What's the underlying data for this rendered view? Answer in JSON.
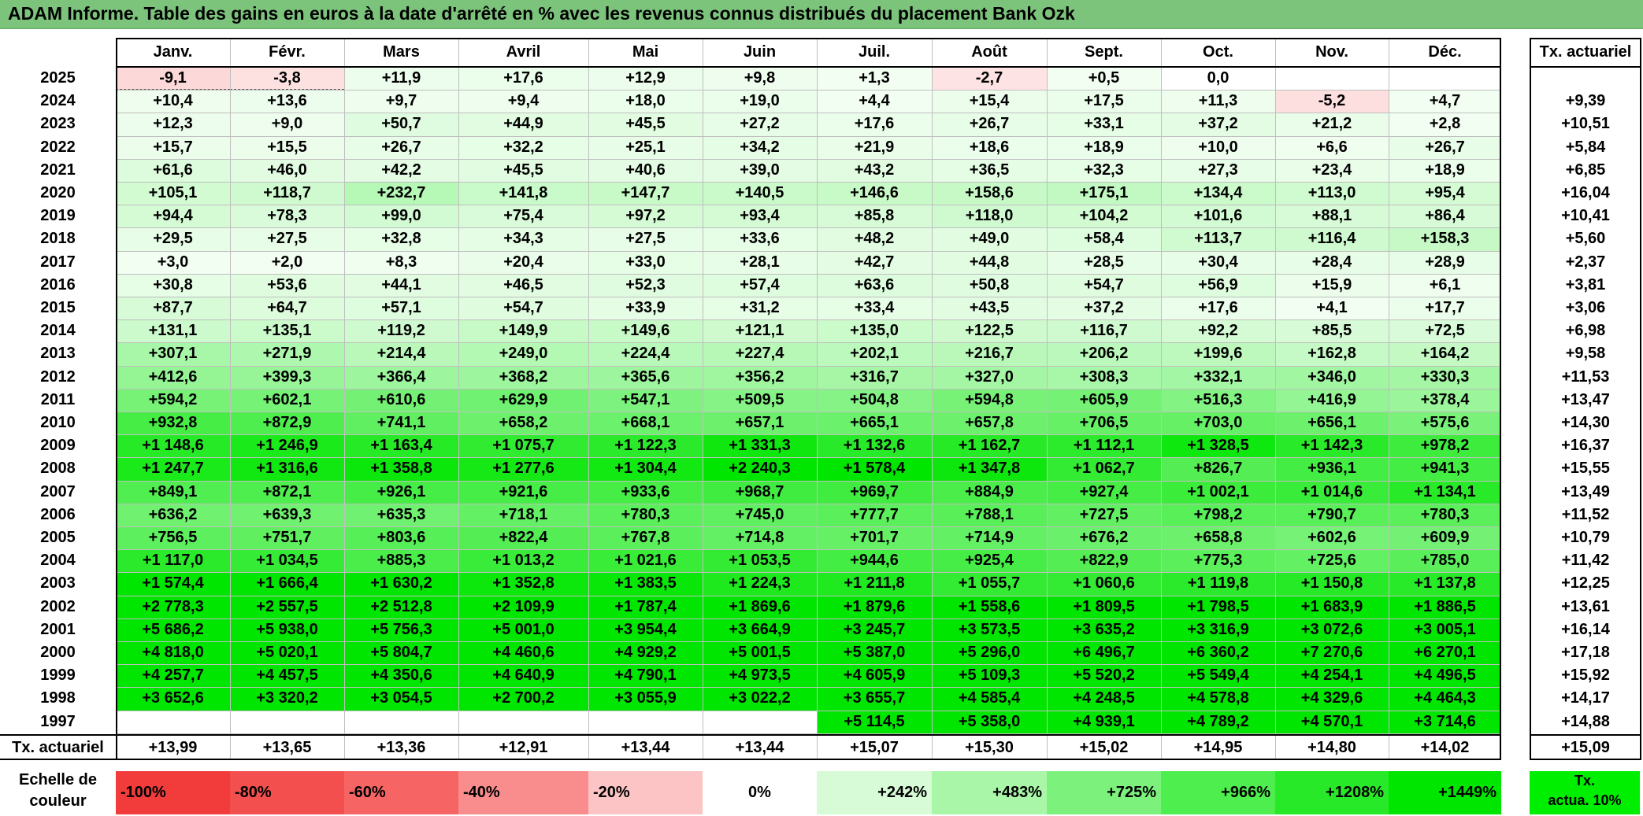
{
  "title": "ADAM Informe. Table des gains en euros à la date d'arrêté en % avec les revenus connus distribués du placement Bank Ozk",
  "months": [
    "Janv.",
    "Févr.",
    "Mars",
    "Avril",
    "Mai",
    "Juin",
    "Juil.",
    "Août",
    "Sept.",
    "Oct.",
    "Nov.",
    "Déc."
  ],
  "tx_header": "Tx. actuariel",
  "footer_label": "Tx. actuariel",
  "footer_total": "+15,09",
  "footer": [
    "+13,99",
    "+13,65",
    "+13,36",
    "+12,91",
    "+13,44",
    "+13,44",
    "+15,07",
    "+15,30",
    "+15,02",
    "+14,95",
    "+14,80",
    "+14,02"
  ],
  "legend": {
    "label_line1": "Echelle de",
    "label_line2": "couleur",
    "items": [
      "-100%",
      "-80%",
      "-60%",
      "-40%",
      "-20%",
      "0%",
      "+242%",
      "+483%",
      "+725%",
      "+966%",
      "+1208%",
      "+1449%"
    ],
    "colors": [
      "#f23c3c",
      "#f44f4f",
      "#f76464",
      "#f98c8c",
      "#fcc4c4",
      "#ffffff",
      "#d6fbd6",
      "#a9f6a9",
      "#7cf27c",
      "#4fee4f",
      "#28e928",
      "#00e600"
    ],
    "tx_line1": "Tx.",
    "tx_line2": "actua. 10%",
    "tx_color": "#00ee00"
  },
  "chart_data": {
    "type": "heatmap",
    "title": "ADAM Informe. Table des gains en euros à la date d'arrêté en % avec les revenus connus distribués du placement Bank Ozk",
    "x": [
      "Janv.",
      "Févr.",
      "Mars",
      "Avril",
      "Mai",
      "Juin",
      "Juil.",
      "Août",
      "Sept.",
      "Oct.",
      "Nov.",
      "Déc."
    ],
    "color_scale": {
      "min": -100,
      "max": 1449,
      "low_color": "#f23c3c",
      "mid_color": "#ffffff",
      "high_color": "#00e600"
    },
    "rows": [
      {
        "year": "2025",
        "values": [
          "-9,1",
          "-3,8",
          "+11,9",
          "+17,6",
          "+12,9",
          "+9,8",
          "+1,3",
          "-2,7",
          "+0,5",
          "0,0",
          "",
          ""
        ],
        "tx": ""
      },
      {
        "year": "2024",
        "values": [
          "+10,4",
          "+13,6",
          "+9,7",
          "+9,4",
          "+18,0",
          "+19,0",
          "+4,4",
          "+15,4",
          "+17,5",
          "+11,3",
          "-5,2",
          "+4,7"
        ],
        "tx": "+9,39"
      },
      {
        "year": "2023",
        "values": [
          "+12,3",
          "+9,0",
          "+50,7",
          "+44,9",
          "+45,5",
          "+27,2",
          "+17,6",
          "+26,7",
          "+33,1",
          "+37,2",
          "+21,2",
          "+2,8"
        ],
        "tx": "+10,51"
      },
      {
        "year": "2022",
        "values": [
          "+15,7",
          "+15,5",
          "+26,7",
          "+32,2",
          "+25,1",
          "+34,2",
          "+21,9",
          "+18,6",
          "+18,9",
          "+10,0",
          "+6,6",
          "+26,7"
        ],
        "tx": "+5,84"
      },
      {
        "year": "2021",
        "values": [
          "+61,6",
          "+46,0",
          "+42,2",
          "+45,5",
          "+40,6",
          "+39,0",
          "+43,2",
          "+36,5",
          "+32,3",
          "+27,3",
          "+23,4",
          "+18,9"
        ],
        "tx": "+6,85"
      },
      {
        "year": "2020",
        "values": [
          "+105,1",
          "+118,7",
          "+232,7",
          "+141,8",
          "+147,7",
          "+140,5",
          "+146,6",
          "+158,6",
          "+175,1",
          "+134,4",
          "+113,0",
          "+95,4"
        ],
        "tx": "+16,04"
      },
      {
        "year": "2019",
        "values": [
          "+94,4",
          "+78,3",
          "+99,0",
          "+75,4",
          "+97,2",
          "+93,4",
          "+85,8",
          "+118,0",
          "+104,2",
          "+101,6",
          "+88,1",
          "+86,4"
        ],
        "tx": "+10,41"
      },
      {
        "year": "2018",
        "values": [
          "+29,5",
          "+27,5",
          "+32,8",
          "+34,3",
          "+27,5",
          "+33,6",
          "+48,2",
          "+49,0",
          "+58,4",
          "+113,7",
          "+116,4",
          "+158,3"
        ],
        "tx": "+5,60"
      },
      {
        "year": "2017",
        "values": [
          "+3,0",
          "+2,0",
          "+8,3",
          "+20,4",
          "+33,0",
          "+28,1",
          "+42,7",
          "+44,8",
          "+28,5",
          "+30,4",
          "+28,4",
          "+28,9"
        ],
        "tx": "+2,37"
      },
      {
        "year": "2016",
        "values": [
          "+30,8",
          "+53,6",
          "+44,1",
          "+46,5",
          "+52,3",
          "+57,4",
          "+63,6",
          "+50,8",
          "+54,7",
          "+56,9",
          "+15,9",
          "+6,1"
        ],
        "tx": "+3,81"
      },
      {
        "year": "2015",
        "values": [
          "+87,7",
          "+64,7",
          "+57,1",
          "+54,7",
          "+33,9",
          "+31,2",
          "+33,4",
          "+43,5",
          "+37,2",
          "+17,6",
          "+4,1",
          "+17,7"
        ],
        "tx": "+3,06"
      },
      {
        "year": "2014",
        "values": [
          "+131,1",
          "+135,1",
          "+119,2",
          "+149,9",
          "+149,6",
          "+121,1",
          "+135,0",
          "+122,5",
          "+116,7",
          "+92,2",
          "+85,5",
          "+72,5"
        ],
        "tx": "+6,98"
      },
      {
        "year": "2013",
        "values": [
          "+307,1",
          "+271,9",
          "+214,4",
          "+249,0",
          "+224,4",
          "+227,4",
          "+202,1",
          "+216,7",
          "+206,2",
          "+199,6",
          "+162,8",
          "+164,2"
        ],
        "tx": "+9,58"
      },
      {
        "year": "2012",
        "values": [
          "+412,6",
          "+399,3",
          "+366,4",
          "+368,2",
          "+365,6",
          "+356,2",
          "+316,7",
          "+327,0",
          "+308,3",
          "+332,1",
          "+346,0",
          "+330,3"
        ],
        "tx": "+11,53"
      },
      {
        "year": "2011",
        "values": [
          "+594,2",
          "+602,1",
          "+610,6",
          "+629,9",
          "+547,1",
          "+509,5",
          "+504,8",
          "+594,8",
          "+605,9",
          "+516,3",
          "+416,9",
          "+378,4"
        ],
        "tx": "+13,47"
      },
      {
        "year": "2010",
        "values": [
          "+932,8",
          "+872,9",
          "+741,1",
          "+658,2",
          "+668,1",
          "+657,1",
          "+665,1",
          "+657,8",
          "+706,5",
          "+703,0",
          "+656,1",
          "+575,6"
        ],
        "tx": "+14,30"
      },
      {
        "year": "2009",
        "values": [
          "+1 148,6",
          "+1 246,9",
          "+1 163,4",
          "+1 075,7",
          "+1 122,3",
          "+1 331,3",
          "+1 132,6",
          "+1 162,7",
          "+1 112,1",
          "+1 328,5",
          "+1 142,3",
          "+978,2"
        ],
        "tx": "+16,37"
      },
      {
        "year": "2008",
        "values": [
          "+1 247,7",
          "+1 316,6",
          "+1 358,8",
          "+1 277,6",
          "+1 304,4",
          "+2 240,3",
          "+1 578,4",
          "+1 347,8",
          "+1 062,7",
          "+826,7",
          "+936,1",
          "+941,3"
        ],
        "tx": "+15,55"
      },
      {
        "year": "2007",
        "values": [
          "+849,1",
          "+872,1",
          "+926,1",
          "+921,6",
          "+933,6",
          "+968,7",
          "+969,7",
          "+884,9",
          "+927,4",
          "+1 002,1",
          "+1 014,6",
          "+1 134,1"
        ],
        "tx": "+13,49"
      },
      {
        "year": "2006",
        "values": [
          "+636,2",
          "+639,3",
          "+635,3",
          "+718,1",
          "+780,3",
          "+745,0",
          "+777,7",
          "+788,1",
          "+727,5",
          "+798,2",
          "+790,7",
          "+780,3"
        ],
        "tx": "+11,52"
      },
      {
        "year": "2005",
        "values": [
          "+756,5",
          "+751,7",
          "+803,6",
          "+822,4",
          "+767,8",
          "+714,8",
          "+701,7",
          "+714,9",
          "+676,2",
          "+658,8",
          "+602,6",
          "+609,9"
        ],
        "tx": "+10,79"
      },
      {
        "year": "2004",
        "values": [
          "+1 117,0",
          "+1 034,5",
          "+885,3",
          "+1 013,2",
          "+1 021,6",
          "+1 053,5",
          "+944,6",
          "+925,4",
          "+822,9",
          "+775,3",
          "+725,6",
          "+785,0"
        ],
        "tx": "+11,42"
      },
      {
        "year": "2003",
        "values": [
          "+1 574,4",
          "+1 666,4",
          "+1 630,2",
          "+1 352,8",
          "+1 383,5",
          "+1 224,3",
          "+1 211,8",
          "+1 055,7",
          "+1 060,6",
          "+1 119,8",
          "+1 150,8",
          "+1 137,8"
        ],
        "tx": "+12,25"
      },
      {
        "year": "2002",
        "values": [
          "+2 778,3",
          "+2 557,5",
          "+2 512,8",
          "+2 109,9",
          "+1 787,4",
          "+1 869,6",
          "+1 879,6",
          "+1 558,6",
          "+1 809,5",
          "+1 798,5",
          "+1 683,9",
          "+1 886,5"
        ],
        "tx": "+13,61"
      },
      {
        "year": "2001",
        "values": [
          "+5 686,2",
          "+5 938,0",
          "+5 756,3",
          "+5 001,0",
          "+3 954,4",
          "+3 664,9",
          "+3 245,7",
          "+3 573,5",
          "+3 635,2",
          "+3 316,9",
          "+3 072,6",
          "+3 005,1"
        ],
        "tx": "+16,14"
      },
      {
        "year": "2000",
        "values": [
          "+4 818,0",
          "+5 020,1",
          "+5 804,7",
          "+4 460,6",
          "+4 929,2",
          "+5 001,5",
          "+5 387,0",
          "+5 296,0",
          "+6 496,7",
          "+6 360,2",
          "+7 270,6",
          "+6 270,1"
        ],
        "tx": "+17,18"
      },
      {
        "year": "1999",
        "values": [
          "+4 257,7",
          "+4 457,5",
          "+4 350,6",
          "+4 640,9",
          "+4 790,1",
          "+4 973,5",
          "+4 605,9",
          "+5 109,3",
          "+5 520,2",
          "+5 549,4",
          "+4 254,1",
          "+4 496,5"
        ],
        "tx": "+15,92"
      },
      {
        "year": "1998",
        "values": [
          "+3 652,6",
          "+3 320,2",
          "+3 054,5",
          "+2 700,2",
          "+3 055,9",
          "+3 022,2",
          "+3 655,7",
          "+4 585,4",
          "+4 248,5",
          "+4 578,8",
          "+4 329,6",
          "+4 464,3"
        ],
        "tx": "+14,17"
      },
      {
        "year": "1997",
        "values": [
          "",
          "",
          "",
          "",
          "",
          "",
          "+5 114,5",
          "+5 358,0",
          "+4 939,1",
          "+4 789,2",
          "+4 570,1",
          "+3 714,6"
        ],
        "tx": "+14,88"
      }
    ]
  }
}
